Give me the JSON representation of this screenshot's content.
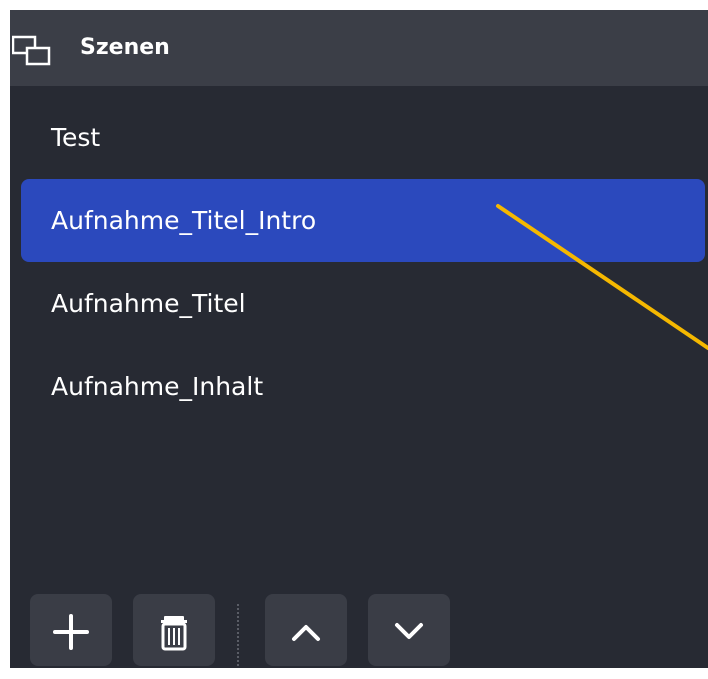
{
  "panel": {
    "title": "Szenen",
    "title_icon": "scenes-icon"
  },
  "scenes": [
    {
      "label": "Test",
      "selected": false
    },
    {
      "label": "Aufnahme_Titel_Intro",
      "selected": true
    },
    {
      "label": "Aufnahme_Titel",
      "selected": false
    },
    {
      "label": "Aufnahme_Inhalt",
      "selected": false
    }
  ],
  "toolbar": {
    "add_icon": "plus-icon",
    "remove_icon": "trash-icon",
    "up_icon": "chevron-up-icon",
    "down_icon": "chevron-down-icon"
  },
  "colors": {
    "panel_bg": "#272a33",
    "header_bg": "#3b3e47",
    "selected_bg": "#2b49bd",
    "button_bg": "#3a3d46",
    "annotation_line": "#f5b800"
  }
}
